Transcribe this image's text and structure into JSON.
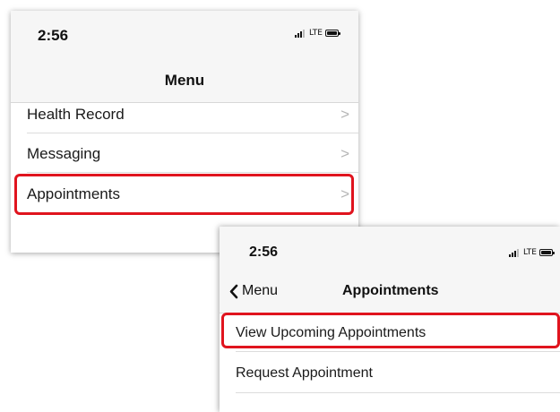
{
  "menu_screen": {
    "status_bar": {
      "time": "2:56",
      "network": "LTE"
    },
    "nav": {
      "title": "Menu"
    },
    "items": [
      {
        "label": "Health Record",
        "chevron": ">"
      },
      {
        "label": "Messaging",
        "chevron": ">"
      },
      {
        "label": "Appointments",
        "chevron": ">",
        "highlighted": true
      }
    ]
  },
  "appointments_screen": {
    "status_bar": {
      "time": "2:56",
      "network": "LTE"
    },
    "nav": {
      "back_label": "Menu",
      "title": "Appointments"
    },
    "items": [
      {
        "label": "View Upcoming Appointments",
        "highlighted": true
      },
      {
        "label": "Request Appointment"
      }
    ]
  },
  "colors": {
    "highlight": "#e0141e",
    "chevron": "#b5b5b5",
    "bar_background": "#f6f6f6",
    "divider": "#dcdcdc"
  }
}
